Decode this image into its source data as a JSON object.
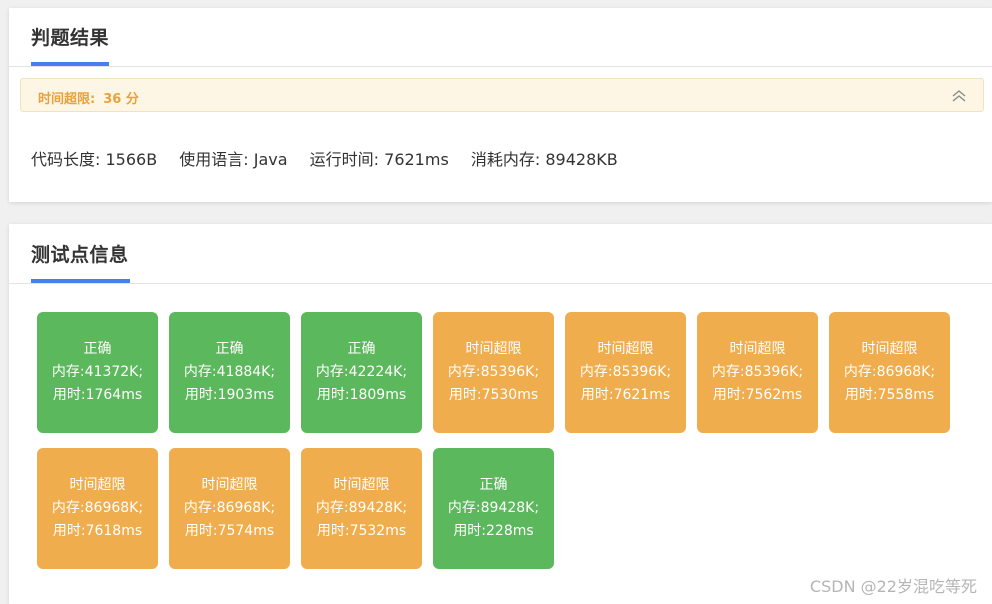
{
  "result_card": {
    "title": "判题结果",
    "status_label": "时间超限:",
    "score": "36 分",
    "stats": [
      "代码长度: 1566B",
      "使用语言: Java",
      "运行时间: 7621ms",
      "消耗内存: 89428KB"
    ]
  },
  "tests_card": {
    "title": "测试点信息",
    "tests": [
      {
        "status": "正确",
        "memory": "内存:41372K;",
        "time": "用时:1764ms",
        "passed": true
      },
      {
        "status": "正确",
        "memory": "内存:41884K;",
        "time": "用时:1903ms",
        "passed": true
      },
      {
        "status": "正确",
        "memory": "内存:42224K;",
        "time": "用时:1809ms",
        "passed": true
      },
      {
        "status": "时间超限",
        "memory": "内存:85396K;",
        "time": "用时:7530ms",
        "passed": false
      },
      {
        "status": "时间超限",
        "memory": "内存:85396K;",
        "time": "用时:7621ms",
        "passed": false
      },
      {
        "status": "时间超限",
        "memory": "内存:85396K;",
        "time": "用时:7562ms",
        "passed": false
      },
      {
        "status": "时间超限",
        "memory": "内存:86968K;",
        "time": "用时:7558ms",
        "passed": false
      },
      {
        "status": "时间超限",
        "memory": "内存:86968K;",
        "time": "用时:7618ms",
        "passed": false
      },
      {
        "status": "时间超限",
        "memory": "内存:86968K;",
        "time": "用时:7574ms",
        "passed": false
      },
      {
        "status": "时间超限",
        "memory": "内存:89428K;",
        "time": "用时:7532ms",
        "passed": false
      },
      {
        "status": "正确",
        "memory": "内存:89428K;",
        "time": "用时:228ms",
        "passed": true
      }
    ]
  },
  "colors": {
    "pass": "#5cb85c",
    "fail": "#f0ad4e",
    "accent": "#4a7ef0",
    "warning_text": "#e9a23b"
  },
  "watermark": "CSDN @22岁混吃等死"
}
